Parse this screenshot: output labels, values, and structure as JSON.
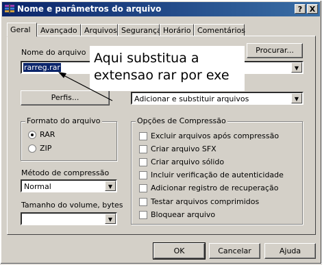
{
  "window": {
    "title": "Nome e parâmetros do arquivo",
    "help_btn": "?",
    "close_btn": "X"
  },
  "tabs": [
    "Geral",
    "Avançado",
    "Arquivos",
    "Segurança",
    "Horário",
    "Comentários"
  ],
  "archive": {
    "label": "Nome do arquivo",
    "value": "rarreg.rar",
    "browse_btn": "Procurar...",
    "profiles_btn": "Perfis...",
    "update_mode": "Adicionar e substituir arquivos"
  },
  "format": {
    "label": "Formato do arquivo",
    "options": [
      "RAR",
      "ZIP"
    ],
    "selected": "RAR"
  },
  "compression": {
    "label": "Método de compressão",
    "value": "Normal"
  },
  "volume": {
    "label": "Tamanho do volume, bytes",
    "value": ""
  },
  "options": {
    "label": "Opções de Compressão",
    "items": [
      "Excluir arquivos após compressão",
      "Criar arquivo SFX",
      "Criar arquivo sólido",
      "Incluir verificação de autenticidade",
      "Adicionar registro de recuperação",
      "Testar arquivos comprimidos",
      "Bloquear arquivo"
    ]
  },
  "callout": {
    "line1": "Aqui substitua a",
    "line2": "extensao rar por exe"
  },
  "buttons": {
    "ok": "OK",
    "cancel": "Cancelar",
    "help": "Ajuda"
  }
}
